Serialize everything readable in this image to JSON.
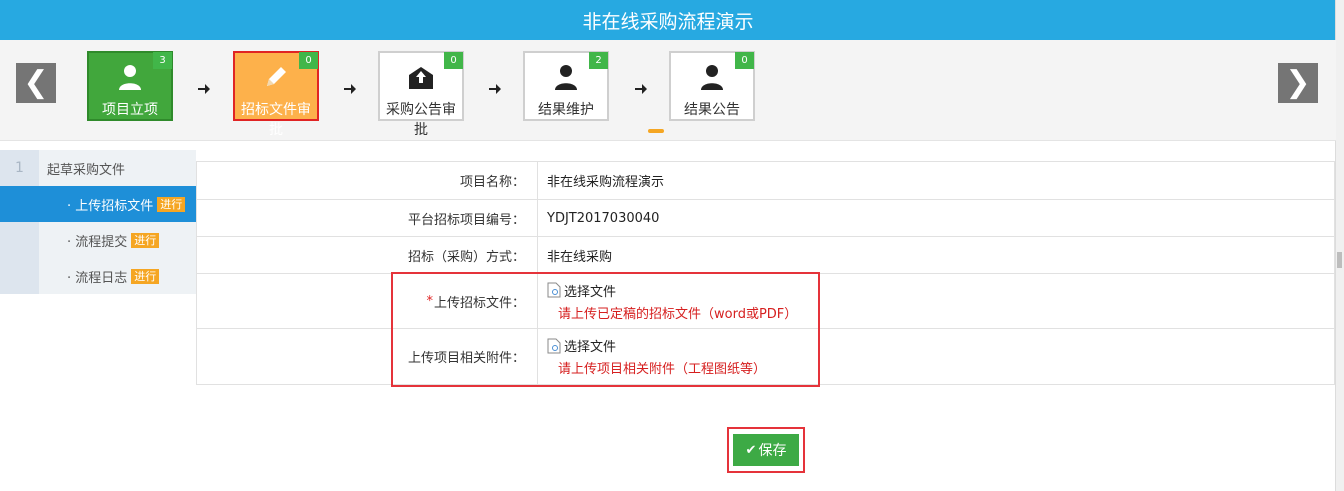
{
  "window": {
    "title": "非在线采购流程演示"
  },
  "steps": [
    {
      "label": "项目立项",
      "count": "3",
      "icon": "user-icon",
      "state": "done"
    },
    {
      "label": "招标文件审批",
      "count": "0",
      "icon": "pencil-icon",
      "state": "active"
    },
    {
      "label": "采购公告审批",
      "count": "0",
      "icon": "envelope-upload-icon",
      "state": "pending"
    },
    {
      "label": "结果维护",
      "count": "2",
      "icon": "user-icon",
      "state": "pending"
    },
    {
      "label": "结果公告",
      "count": "0",
      "icon": "user-icon",
      "state": "pending"
    }
  ],
  "nav": {
    "prev": "❮",
    "next": "❯"
  },
  "sidebar": {
    "section_number": "1",
    "section_title": "起草采购文件",
    "items": [
      {
        "label": "· 上传招标文件",
        "tag": "进行",
        "current": true
      },
      {
        "label": "· 流程提交",
        "tag": "进行",
        "current": false
      },
      {
        "label": "· 流程日志",
        "tag": "进行",
        "current": false
      }
    ]
  },
  "form": {
    "project_name_label": "项目名称：",
    "project_name_value": "非在线采购流程演示",
    "project_code_label": "平台招标项目编号：",
    "project_code_value": "YDJT2017030040",
    "method_label": "招标（采购）方式：",
    "method_value": "非在线采购",
    "upload_doc_required_mark": "*",
    "upload_doc_label": "上传招标文件：",
    "upload_doc_button": "选择文件",
    "upload_doc_hint": "请上传已定稿的招标文件（word或PDF）",
    "upload_attach_label": "上传项目相关附件：",
    "upload_attach_button": "选择文件",
    "upload_attach_hint": "请上传项目相关附件（工程图纸等）"
  },
  "actions": {
    "save_label": "保存"
  },
  "colors": {
    "header": "#27a9e1",
    "step_done": "#41a73c",
    "step_active": "#fdb14b",
    "badge": "#41b649",
    "highlight_border": "#e5333a",
    "sidebar_current": "#1e8fd8",
    "tag": "#f5a623",
    "hint_text": "#d61f1f"
  }
}
